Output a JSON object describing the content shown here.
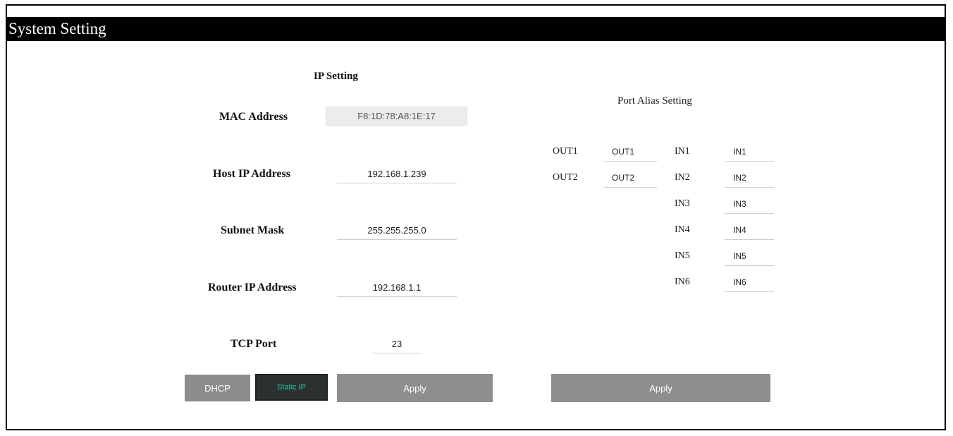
{
  "window": {
    "title": "System Setting"
  },
  "ip_setting": {
    "title": "IP Setting",
    "mac": {
      "label": "MAC Address",
      "value": "F8:1D:78:A8:1E:17"
    },
    "host_ip": {
      "label": "Host IP Address",
      "value": "192.168.1.239"
    },
    "subnet": {
      "label": "Subnet Mask",
      "value": "255.255.255.0"
    },
    "router_ip": {
      "label": "Router IP Address",
      "value": "192.168.1.1"
    },
    "tcp_port": {
      "label": "TCP Port",
      "value": "23"
    },
    "buttons": {
      "dhcp": "DHCP",
      "static": "Static IP",
      "apply": "Apply"
    }
  },
  "port_alias": {
    "title": "Port Alias Setting",
    "outputs": [
      {
        "label": "OUT1",
        "value": "OUT1"
      },
      {
        "label": "OUT2",
        "value": "OUT2"
      }
    ],
    "inputs": [
      {
        "label": "IN1",
        "value": "IN1"
      },
      {
        "label": "IN2",
        "value": "IN2"
      },
      {
        "label": "IN3",
        "value": "IN3"
      },
      {
        "label": "IN4",
        "value": "IN4"
      },
      {
        "label": "IN5",
        "value": "IN5"
      },
      {
        "label": "IN6",
        "value": "IN6"
      }
    ],
    "apply_label": "Apply"
  }
}
